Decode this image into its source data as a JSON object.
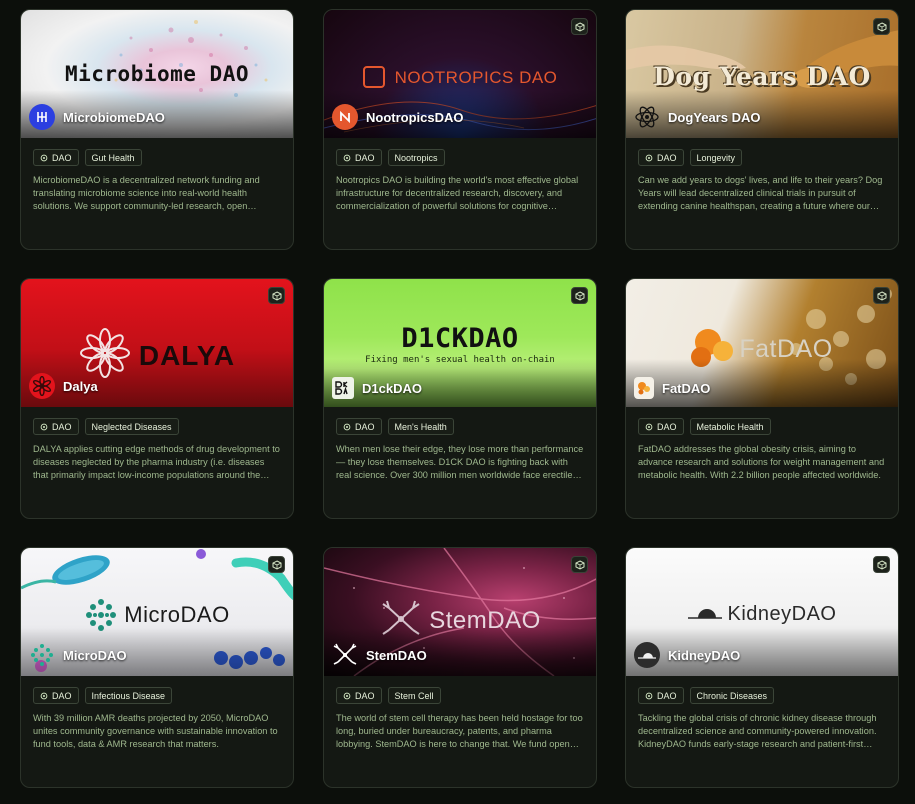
{
  "dao_tag_label": "DAO",
  "cards": [
    {
      "banner_title": "Microbiome DAO",
      "name": "MicrobiomeDAO",
      "category": "Gut Health",
      "description": "MicrobiomeDAO is a decentralized network funding and translating microbiome science into real-world health solutions. We support community-led research, open collaboration, and breakthrough treatments."
    },
    {
      "banner_title": "NOOTROPICS DAO",
      "name": "NootropicsDAO",
      "category": "Nootropics",
      "description": "Nootropics DAO is building the world's most effective global infrastructure for decentralized research, discovery, and commercialization of powerful solutions for cognitive enhancement."
    },
    {
      "banner_title": "Dog Years DAO",
      "name": "DogYears DAO",
      "category": "Longevity",
      "description": "Can we add years to dogs' lives, and life to their years? Dog Years will lead decentralized clinical trials in pursuit of extending canine healthspan, creating a future where our companions live longer."
    },
    {
      "banner_title": "DALYA",
      "name": "Dalya",
      "category": "Neglected Diseases",
      "description": "DALYA applies cutting edge methods of drug development to diseases neglected by the pharma industry (i.e. diseases that primarily impact low-income populations around the world)."
    },
    {
      "banner_title": "D1CKDAO",
      "banner_subtitle": "Fixing men's sexual health on-chain",
      "name": "D1ckDAO",
      "category": "Men's Health",
      "description": "When men lose their edge, they lose more than performance — they lose themselves. D1CK DAO is fighting back with real science. Over 300 million men worldwide face erectile dysfunction."
    },
    {
      "banner_title": "FatDAO",
      "name": "FatDAO",
      "category": "Metabolic Health",
      "description": "FatDAO addresses the global obesity crisis, aiming to advance research and solutions for weight management and metabolic health. With 2.2 billion people affected worldwide."
    },
    {
      "banner_title": "MicroDAO",
      "name": "MicroDAO",
      "category": "Infectious Disease",
      "description": "With 39 million AMR deaths projected by 2050, MicroDAO unites community governance with sustainable innovation to fund tools, data & AMR research that matters."
    },
    {
      "banner_title": "StemDAO",
      "name": "StemDAO",
      "category": "Stem Cell",
      "description": "The world of stem cell therapy has been held hostage for too long, buried under bureaucracy, patents, and pharma lobbying. StemDAO is here to change that. We fund open research."
    },
    {
      "banner_title": "KidneyDAO",
      "name": "KidneyDAO",
      "category": "Chronic Diseases",
      "description": "Tackling the global crisis of chronic kidney disease through decentralized science and community-powered innovation. KidneyDAO funds early-stage research and patient-first solutions."
    }
  ]
}
